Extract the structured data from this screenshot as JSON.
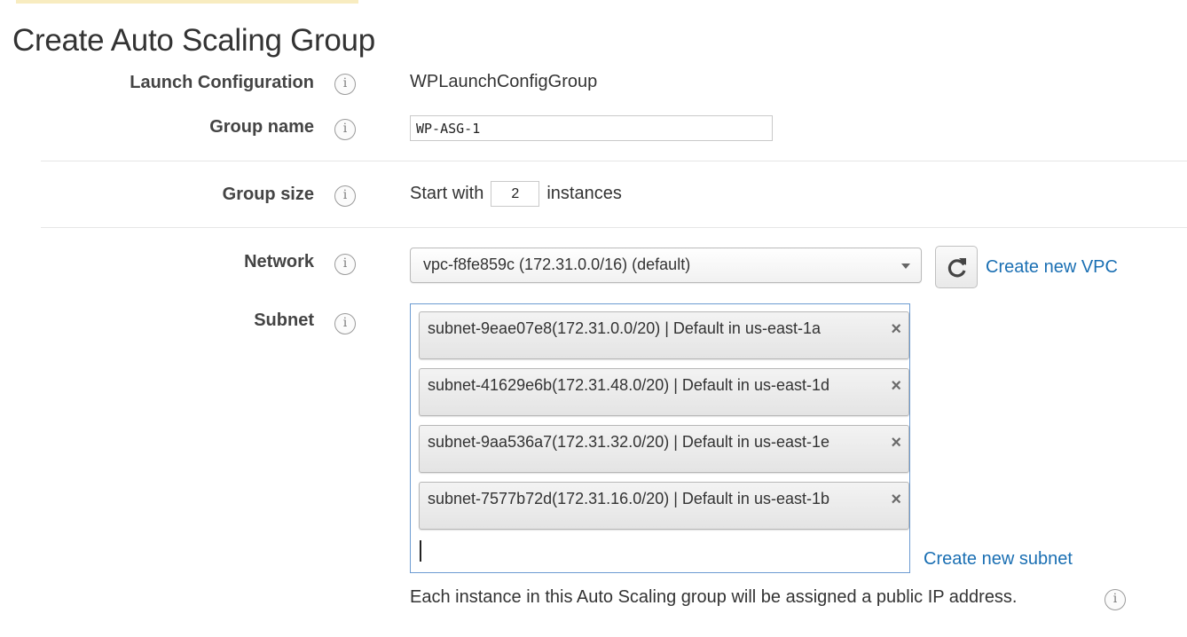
{
  "page": {
    "title": "Create Auto Scaling Group"
  },
  "fields": {
    "launch_configuration": {
      "label": "Launch Configuration",
      "value": "WPLaunchConfigGroup"
    },
    "group_name": {
      "label": "Group name",
      "value": "WP-ASG-1"
    },
    "group_size": {
      "label": "Group size",
      "prefix": "Start with",
      "value": "2",
      "suffix": "instances"
    },
    "network": {
      "label": "Network",
      "selected": "vpc-f8fe859c (172.31.0.0/16) (default)",
      "create_link": "Create new VPC"
    },
    "subnet": {
      "label": "Subnet",
      "tags": [
        "subnet-9eae07e8(172.31.0.0/20) | Default in us-east-1a",
        "subnet-41629e6b(172.31.48.0/20) | Default in us-east-1d",
        "subnet-9aa536a7(172.31.32.0/20) | Default in us-east-1e",
        "subnet-7577b72d(172.31.16.0/20) | Default in us-east-1b"
      ],
      "create_link": "Create new subnet",
      "public_ip_note": "Each instance in this Auto Scaling group will be assigned a public IP address."
    }
  },
  "icons": {
    "info": "info-icon",
    "refresh": "refresh-icon",
    "remove": "close-icon",
    "dropdown": "chevron-down-icon"
  },
  "glyphs": {
    "info": "i",
    "remove": "×"
  },
  "colors": {
    "link": "#1a6fb3",
    "focus_border": "#6c9bd2",
    "label": "#444444",
    "accent_bar": "#f8ecc0"
  }
}
